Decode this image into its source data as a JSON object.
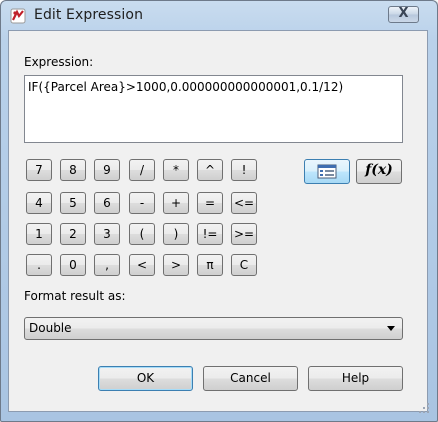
{
  "window": {
    "title": "Edit Expression",
    "close_symbol": "X"
  },
  "expression": {
    "label": "Expression:",
    "value": "IF({Parcel Area}>1000,0.000000000000001,0.1/12)"
  },
  "keypad": {
    "rows": [
      [
        "7",
        "8",
        "9",
        "/",
        "*",
        "^",
        "!"
      ],
      [
        "4",
        "5",
        "6",
        "-",
        "+",
        "=",
        "<="
      ],
      [
        "1",
        "2",
        "3",
        "(",
        ")",
        "!=",
        ">="
      ],
      [
        ".",
        "0",
        ",",
        "<",
        ">",
        "π",
        "C"
      ]
    ]
  },
  "function_buttons": {
    "properties_icon": "properties-list-icon",
    "function_label": "f(x)"
  },
  "format": {
    "label": "Format result as:",
    "selected": "Double"
  },
  "buttons": {
    "ok": "OK",
    "cancel": "Cancel",
    "help": "Help"
  }
}
